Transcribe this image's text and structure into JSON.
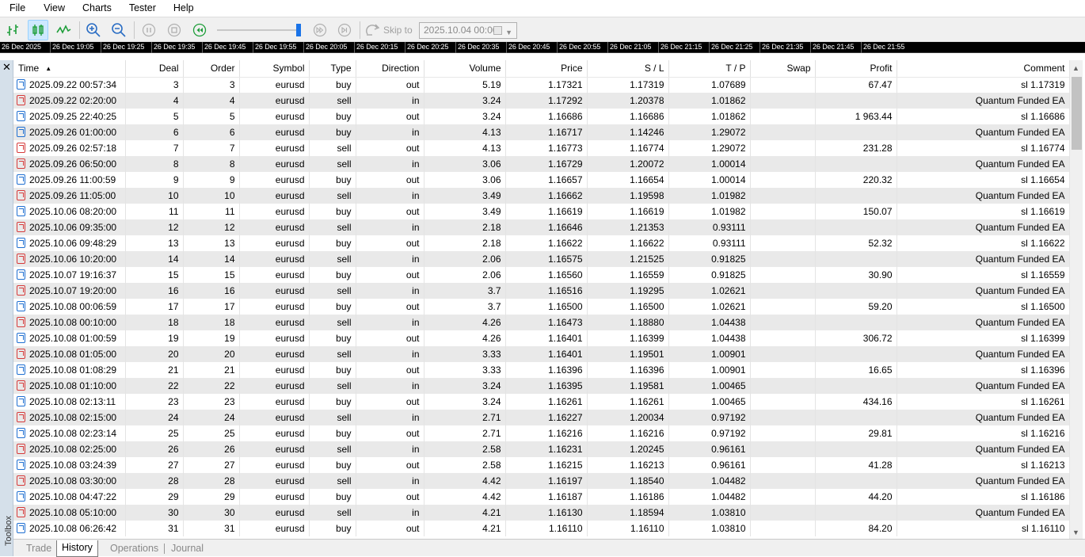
{
  "menu": [
    "File",
    "View",
    "Charts",
    "Tester",
    "Help"
  ],
  "toolbar": {
    "skip_label": "Skip to",
    "skip_date": "2025.10.04 00:00"
  },
  "timescale": [
    "26 Dec 2025",
    "26 Dec 19:05",
    "26 Dec 19:25",
    "26 Dec 19:35",
    "26 Dec 19:45",
    "26 Dec 19:55",
    "26 Dec 20:05",
    "26 Dec 20:15",
    "26 Dec 20:25",
    "26 Dec 20:35",
    "26 Dec 20:45",
    "26 Dec 20:55",
    "26 Dec 21:05",
    "26 Dec 21:15",
    "26 Dec 21:25",
    "26 Dec 21:35",
    "26 Dec 21:45",
    "26 Dec 21:55"
  ],
  "toolbox_label": "Toolbox",
  "columns": [
    "Time",
    "Deal",
    "Order",
    "Symbol",
    "Type",
    "Direction",
    "Volume",
    "Price",
    "S / L",
    "T / P",
    "Swap",
    "Profit",
    "Comment"
  ],
  "rows": [
    [
      "2025.09.22 00:57:34",
      "3",
      "3",
      "eurusd",
      "buy",
      "out",
      "5.19",
      "1.17321",
      "1.17319",
      "1.07689",
      "",
      "67.47",
      "sl 1.17319"
    ],
    [
      "2025.09.22 02:20:00",
      "4",
      "4",
      "eurusd",
      "sell",
      "in",
      "3.24",
      "1.17292",
      "1.20378",
      "1.01862",
      "",
      "",
      "Quantum Funded EA"
    ],
    [
      "2025.09.25 22:40:25",
      "5",
      "5",
      "eurusd",
      "buy",
      "out",
      "3.24",
      "1.16686",
      "1.16686",
      "1.01862",
      "",
      "1 963.44",
      "sl 1.16686"
    ],
    [
      "2025.09.26 01:00:00",
      "6",
      "6",
      "eurusd",
      "buy",
      "in",
      "4.13",
      "1.16717",
      "1.14246",
      "1.29072",
      "",
      "",
      "Quantum Funded EA"
    ],
    [
      "2025.09.26 02:57:18",
      "7",
      "7",
      "eurusd",
      "sell",
      "out",
      "4.13",
      "1.16773",
      "1.16774",
      "1.29072",
      "",
      "231.28",
      "sl 1.16774"
    ],
    [
      "2025.09.26 06:50:00",
      "8",
      "8",
      "eurusd",
      "sell",
      "in",
      "3.06",
      "1.16729",
      "1.20072",
      "1.00014",
      "",
      "",
      "Quantum Funded EA"
    ],
    [
      "2025.09.26 11:00:59",
      "9",
      "9",
      "eurusd",
      "buy",
      "out",
      "3.06",
      "1.16657",
      "1.16654",
      "1.00014",
      "",
      "220.32",
      "sl 1.16654"
    ],
    [
      "2025.09.26 11:05:00",
      "10",
      "10",
      "eurusd",
      "sell",
      "in",
      "3.49",
      "1.16662",
      "1.19598",
      "1.01982",
      "",
      "",
      "Quantum Funded EA"
    ],
    [
      "2025.10.06 08:20:00",
      "11",
      "11",
      "eurusd",
      "buy",
      "out",
      "3.49",
      "1.16619",
      "1.16619",
      "1.01982",
      "",
      "150.07",
      "sl 1.16619"
    ],
    [
      "2025.10.06 09:35:00",
      "12",
      "12",
      "eurusd",
      "sell",
      "in",
      "2.18",
      "1.16646",
      "1.21353",
      "0.93111",
      "",
      "",
      "Quantum Funded EA"
    ],
    [
      "2025.10.06 09:48:29",
      "13",
      "13",
      "eurusd",
      "buy",
      "out",
      "2.18",
      "1.16622",
      "1.16622",
      "0.93111",
      "",
      "52.32",
      "sl 1.16622"
    ],
    [
      "2025.10.06 10:20:00",
      "14",
      "14",
      "eurusd",
      "sell",
      "in",
      "2.06",
      "1.16575",
      "1.21525",
      "0.91825",
      "",
      "",
      "Quantum Funded EA"
    ],
    [
      "2025.10.07 19:16:37",
      "15",
      "15",
      "eurusd",
      "buy",
      "out",
      "2.06",
      "1.16560",
      "1.16559",
      "0.91825",
      "",
      "30.90",
      "sl 1.16559"
    ],
    [
      "2025.10.07 19:20:00",
      "16",
      "16",
      "eurusd",
      "sell",
      "in",
      "3.7",
      "1.16516",
      "1.19295",
      "1.02621",
      "",
      "",
      "Quantum Funded EA"
    ],
    [
      "2025.10.08 00:06:59",
      "17",
      "17",
      "eurusd",
      "buy",
      "out",
      "3.7",
      "1.16500",
      "1.16500",
      "1.02621",
      "",
      "59.20",
      "sl 1.16500"
    ],
    [
      "2025.10.08 00:10:00",
      "18",
      "18",
      "eurusd",
      "sell",
      "in",
      "4.26",
      "1.16473",
      "1.18880",
      "1.04438",
      "",
      "",
      "Quantum Funded EA"
    ],
    [
      "2025.10.08 01:00:59",
      "19",
      "19",
      "eurusd",
      "buy",
      "out",
      "4.26",
      "1.16401",
      "1.16399",
      "1.04438",
      "",
      "306.72",
      "sl 1.16399"
    ],
    [
      "2025.10.08 01:05:00",
      "20",
      "20",
      "eurusd",
      "sell",
      "in",
      "3.33",
      "1.16401",
      "1.19501",
      "1.00901",
      "",
      "",
      "Quantum Funded EA"
    ],
    [
      "2025.10.08 01:08:29",
      "21",
      "21",
      "eurusd",
      "buy",
      "out",
      "3.33",
      "1.16396",
      "1.16396",
      "1.00901",
      "",
      "16.65",
      "sl 1.16396"
    ],
    [
      "2025.10.08 01:10:00",
      "22",
      "22",
      "eurusd",
      "sell",
      "in",
      "3.24",
      "1.16395",
      "1.19581",
      "1.00465",
      "",
      "",
      "Quantum Funded EA"
    ],
    [
      "2025.10.08 02:13:11",
      "23",
      "23",
      "eurusd",
      "buy",
      "out",
      "3.24",
      "1.16261",
      "1.16261",
      "1.00465",
      "",
      "434.16",
      "sl 1.16261"
    ],
    [
      "2025.10.08 02:15:00",
      "24",
      "24",
      "eurusd",
      "sell",
      "in",
      "2.71",
      "1.16227",
      "1.20034",
      "0.97192",
      "",
      "",
      "Quantum Funded EA"
    ],
    [
      "2025.10.08 02:23:14",
      "25",
      "25",
      "eurusd",
      "buy",
      "out",
      "2.71",
      "1.16216",
      "1.16216",
      "0.97192",
      "",
      "29.81",
      "sl 1.16216"
    ],
    [
      "2025.10.08 02:25:00",
      "26",
      "26",
      "eurusd",
      "sell",
      "in",
      "2.58",
      "1.16231",
      "1.20245",
      "0.96161",
      "",
      "",
      "Quantum Funded EA"
    ],
    [
      "2025.10.08 03:24:39",
      "27",
      "27",
      "eurusd",
      "buy",
      "out",
      "2.58",
      "1.16215",
      "1.16213",
      "0.96161",
      "",
      "41.28",
      "sl 1.16213"
    ],
    [
      "2025.10.08 03:30:00",
      "28",
      "28",
      "eurusd",
      "sell",
      "in",
      "4.42",
      "1.16197",
      "1.18540",
      "1.04482",
      "",
      "",
      "Quantum Funded EA"
    ],
    [
      "2025.10.08 04:47:22",
      "29",
      "29",
      "eurusd",
      "buy",
      "out",
      "4.42",
      "1.16187",
      "1.16186",
      "1.04482",
      "",
      "44.20",
      "sl 1.16186"
    ],
    [
      "2025.10.08 05:10:00",
      "30",
      "30",
      "eurusd",
      "sell",
      "in",
      "4.21",
      "1.16130",
      "1.18594",
      "1.03810",
      "",
      "",
      "Quantum Funded EA"
    ],
    [
      "2025.10.08 06:26:42",
      "31",
      "31",
      "eurusd",
      "buy",
      "out",
      "4.21",
      "1.16110",
      "1.16110",
      "1.03810",
      "",
      "84.20",
      "sl 1.16110"
    ]
  ],
  "tabs": [
    "Trade",
    "History",
    "Operations",
    "Journal"
  ],
  "active_tab": "History",
  "colors": {
    "accent": "#1a73e8",
    "buy": "#1f6fd1",
    "sell": "#d63a3a",
    "row_alt": "#e9e9e9"
  }
}
